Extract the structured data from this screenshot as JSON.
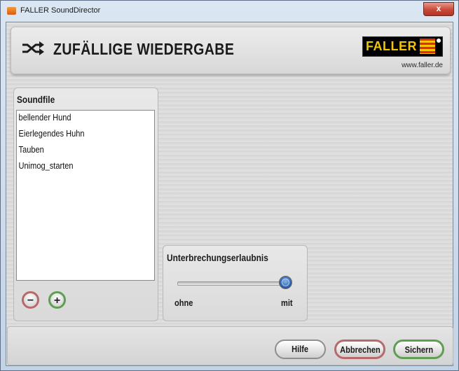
{
  "window": {
    "title": "FALLER SoundDirector",
    "close_label": "x"
  },
  "header": {
    "title": "ZUFÄLLIGE WIEDERGABE",
    "icon": "shuffle-icon",
    "logo_text": "FALLER",
    "website": "www.faller.de"
  },
  "soundfile": {
    "label": "Soundfile",
    "items": [
      {
        "label": "bellender Hund"
      },
      {
        "label": "Eierlegendes Huhn"
      },
      {
        "label": "Tauben"
      },
      {
        "label": "Unimog_starten"
      }
    ],
    "remove_symbol": "−",
    "add_symbol": "+"
  },
  "interruption": {
    "label": "Unterbrechungserlaubnis",
    "min_label": "ohne",
    "max_label": "mit",
    "value": 1.0
  },
  "buttons": {
    "help": "Hilfe",
    "cancel": "Abbrechen",
    "save": "Sichern"
  },
  "colors": {
    "logo_yellow": "#f4c400",
    "logo_red": "#e02a1a",
    "cancel_border": "#b86a6a",
    "save_border": "#5e9f52",
    "slider_thumb": "#2b63b6"
  }
}
